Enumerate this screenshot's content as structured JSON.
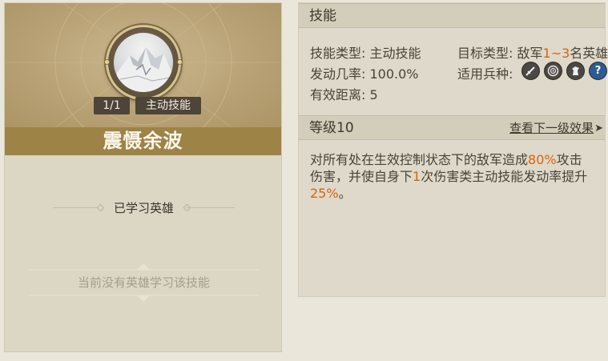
{
  "skill_card": {
    "level": "1/1",
    "type": "主动技能",
    "name": "震慑余波",
    "learned_label": "已学习英雄",
    "none_label": "当前没有英雄学习该技能"
  },
  "skill_panel": {
    "title": "技能",
    "skill_type_label": "技能类型:",
    "skill_type_value": "主动技能",
    "target_type_label": "目标类型:",
    "target_prefix": "敌军",
    "target_range": "1~3",
    "target_suffix": "名英雄",
    "rate_label": "发动几率:",
    "rate_value": "100.0%",
    "unit_label": "适用兵种:",
    "distance_label": "有效距离:",
    "distance_value": "5",
    "unit_icons": [
      "sword-icon",
      "bow-target-icon",
      "horse-icon",
      "question-icon"
    ]
  },
  "level_panel": {
    "title": "等级10",
    "next_link": "查看下一级效果",
    "next_arrow": "➤",
    "desc_parts": [
      {
        "text": "对所有处在生效控制状态下的敌军造成",
        "hl": false
      },
      {
        "text": "80%",
        "hl": true
      },
      {
        "text": "攻击伤害，并使自身下",
        "hl": false
      },
      {
        "text": "1",
        "hl": true
      },
      {
        "text": "次伤害类主动技能发动率提升",
        "hl": false
      },
      {
        "text": "25%",
        "hl": true
      },
      {
        "text": "。",
        "hl": false
      }
    ]
  },
  "colors": {
    "highlight": "#d4650f",
    "name_bar": "#9e8347",
    "badge": "#4d4537"
  }
}
